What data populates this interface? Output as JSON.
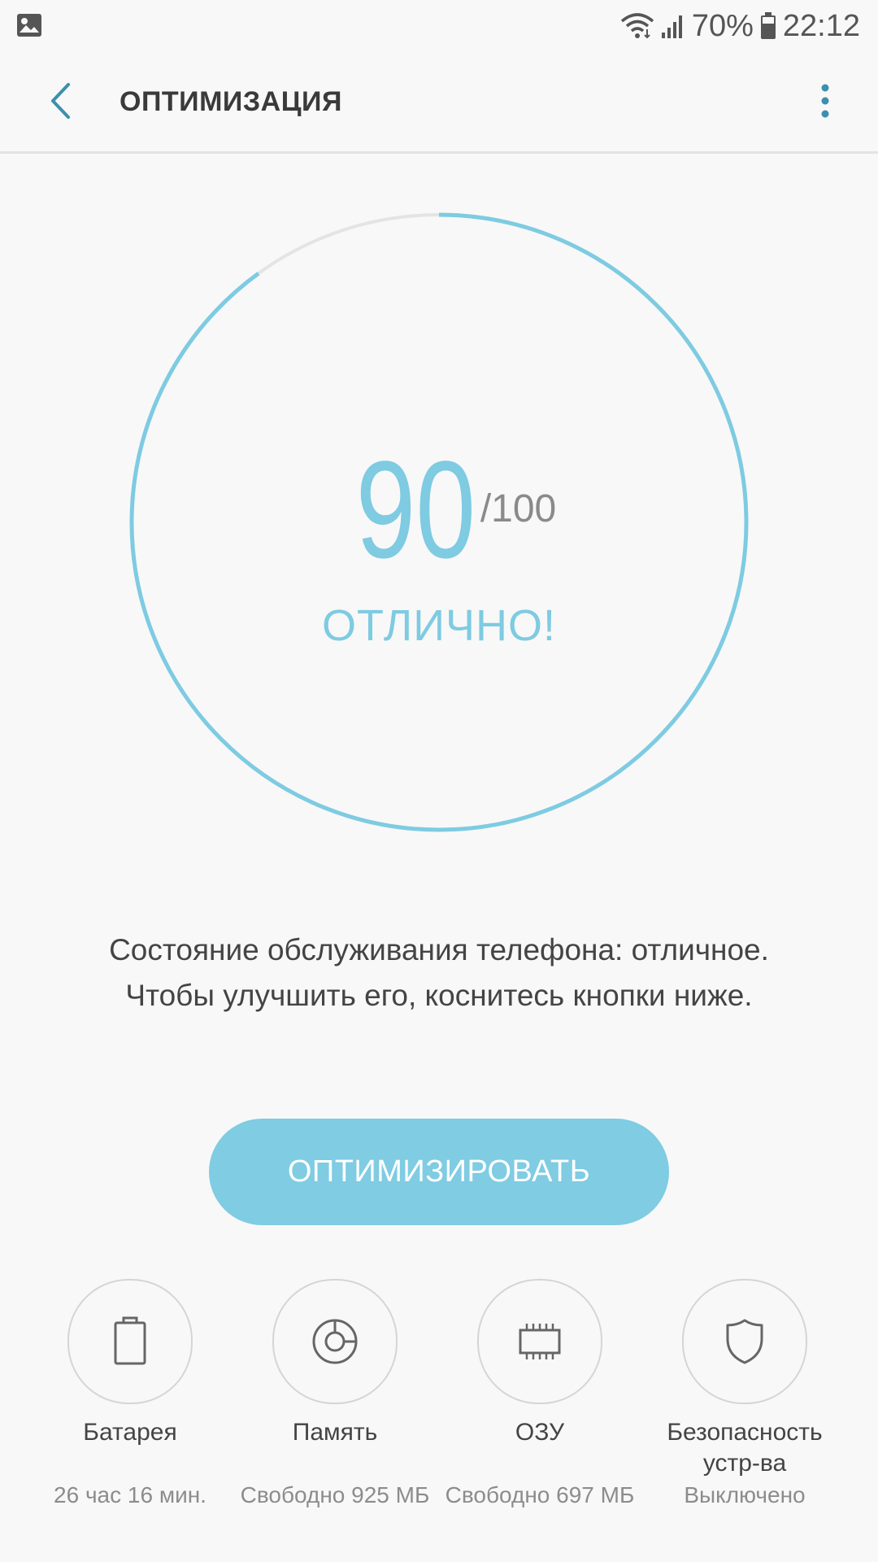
{
  "status_bar": {
    "battery_percent": "70%",
    "time": "22:12",
    "icons": [
      "image-icon",
      "wifi-icon",
      "signal-icon",
      "battery-icon"
    ]
  },
  "app_bar": {
    "title": "ОПТИМИЗАЦИЯ",
    "back_icon": "chevron-left-icon",
    "menu_icon": "more-vertical-icon"
  },
  "score": {
    "value": "90",
    "max_label": "/100",
    "fraction": 0.9,
    "status": "ОТЛИЧНО!"
  },
  "description": {
    "line1": "Состояние обслуживания телефона: отличное.",
    "line2": "Чтобы улучшить его, коснитесь кнопки ниже."
  },
  "optimize_button": {
    "label": "ОПТИМИЗИРОВАТЬ"
  },
  "categories": [
    {
      "label": "Батарея",
      "sub": "26 час 16 мин.",
      "icon": "battery-icon"
    },
    {
      "label": "Память",
      "sub": "Свободно 925 МБ",
      "icon": "storage-icon"
    },
    {
      "label": "ОЗУ",
      "sub": "Свободно 697 МБ",
      "icon": "ram-chip-icon"
    },
    {
      "label": "Безопасность устр-ва",
      "sub": "Выключено",
      "icon": "shield-icon"
    }
  ],
  "colors": {
    "accent": "#7ecbe2",
    "track": "#e4e4e4",
    "title": "#3a3a3a",
    "back_icon": "#3d8fae"
  }
}
